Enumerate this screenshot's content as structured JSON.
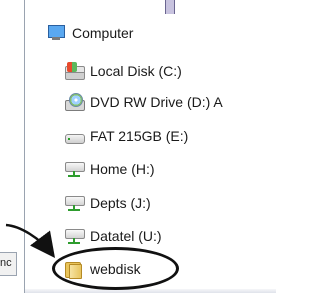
{
  "nav_tree": {
    "items": [
      {
        "id": "computer",
        "label": "Computer",
        "icon": "computer-icon",
        "expanded": true
      },
      {
        "id": "local-disk-c",
        "label": "Local Disk (C:)",
        "icon": "local-disk-icon"
      },
      {
        "id": "dvd-rw-d",
        "label": "DVD RW Drive (D:) A",
        "icon": "dvd-drive-icon"
      },
      {
        "id": "fat-215gb-e",
        "label": "FAT 215GB (E:)",
        "icon": "removable-drive-icon"
      },
      {
        "id": "home-h",
        "label": "Home (H:)",
        "icon": "network-drive-icon"
      },
      {
        "id": "depts-j",
        "label": "Depts (J:)",
        "icon": "network-drive-icon"
      },
      {
        "id": "datatel-u",
        "label": "Datatel (U:)",
        "icon": "network-drive-icon"
      },
      {
        "id": "webdisk",
        "label": "webdisk",
        "icon": "folder-icon",
        "highlighted": true
      }
    ]
  },
  "partial_window": {
    "label": "nc"
  },
  "annotation": {
    "target": "webdisk",
    "color": "#111111"
  }
}
